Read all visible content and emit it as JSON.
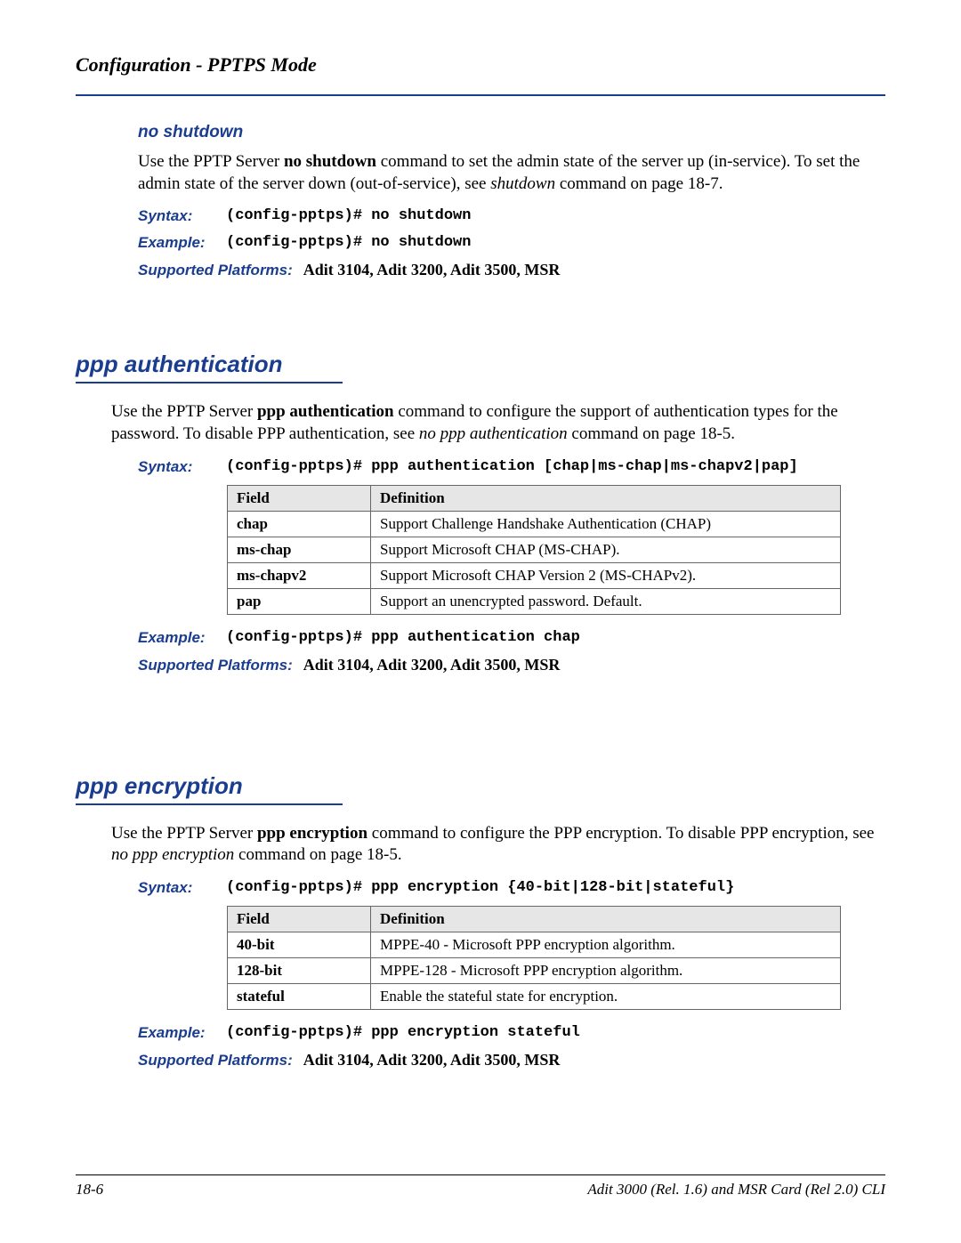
{
  "header": {
    "title": "Configuration - PPTPS Mode"
  },
  "labels": {
    "syntax": "Syntax:",
    "example": "Example:",
    "platforms": "Supported Platforms:",
    "field": "Field",
    "definition": "Definition"
  },
  "no_shutdown": {
    "title": "no shutdown",
    "desc_pre": "Use the PPTP Server ",
    "desc_bold": "no shutdown",
    "desc_mid": " command to set the admin state of the server up (in-service). To set the admin state of the server down (out-of-service), see ",
    "desc_ital": "shutdown",
    "desc_post": " command on page 18-7.",
    "syntax": "(config-pptps)# no shutdown",
    "example": "(config-pptps)# no shutdown",
    "platforms": "Adit 3104, Adit 3200, Adit 3500, MSR"
  },
  "ppp_auth": {
    "title": "ppp authentication",
    "desc_pre": "Use the PPTP Server ",
    "desc_bold": "ppp authentication",
    "desc_mid": " command to configure the support of authentication types for the password. To disable PPP authentication, see ",
    "desc_ital": "no ppp authentication",
    "desc_post": " command on page 18-5.",
    "syntax": "(config-pptps)# ppp authentication [chap|ms-chap|ms-chapv2|pap]",
    "table": [
      {
        "field": "chap",
        "def": "Support Challenge Handshake Authentication (CHAP)"
      },
      {
        "field": "ms-chap",
        "def": "Support Microsoft CHAP (MS-CHAP)."
      },
      {
        "field": "ms-chapv2",
        "def": "Support Microsoft CHAP Version 2 (MS-CHAPv2)."
      },
      {
        "field": "pap",
        "def": "Support an unencrypted password. Default."
      }
    ],
    "example": "(config-pptps)# ppp authentication chap",
    "platforms": "Adit 3104, Adit 3200, Adit 3500, MSR"
  },
  "ppp_enc": {
    "title": "ppp encryption",
    "desc_pre": "Use the PPTP Server ",
    "desc_bold": "ppp encryption",
    "desc_mid": " command to configure the PPP encryption. To disable PPP encryption, see ",
    "desc_ital": "no ppp encryption",
    "desc_post": " command on page 18-5.",
    "syntax": "(config-pptps)# ppp encryption {40-bit|128-bit|stateful}",
    "table": [
      {
        "field": "40-bit",
        "def": "MPPE-40 - Microsoft PPP encryption algorithm."
      },
      {
        "field": "128-bit",
        "def": "MPPE-128 - Microsoft PPP encryption algorithm."
      },
      {
        "field": "stateful",
        "def": "Enable the stateful state for encryption."
      }
    ],
    "example": "(config-pptps)# ppp encryption stateful",
    "platforms": "Adit 3104, Adit 3200, Adit 3500, MSR"
  },
  "footer": {
    "page": "18-6",
    "doc": "Adit 3000 (Rel. 1.6) and MSR Card (Rel 2.0) CLI"
  }
}
